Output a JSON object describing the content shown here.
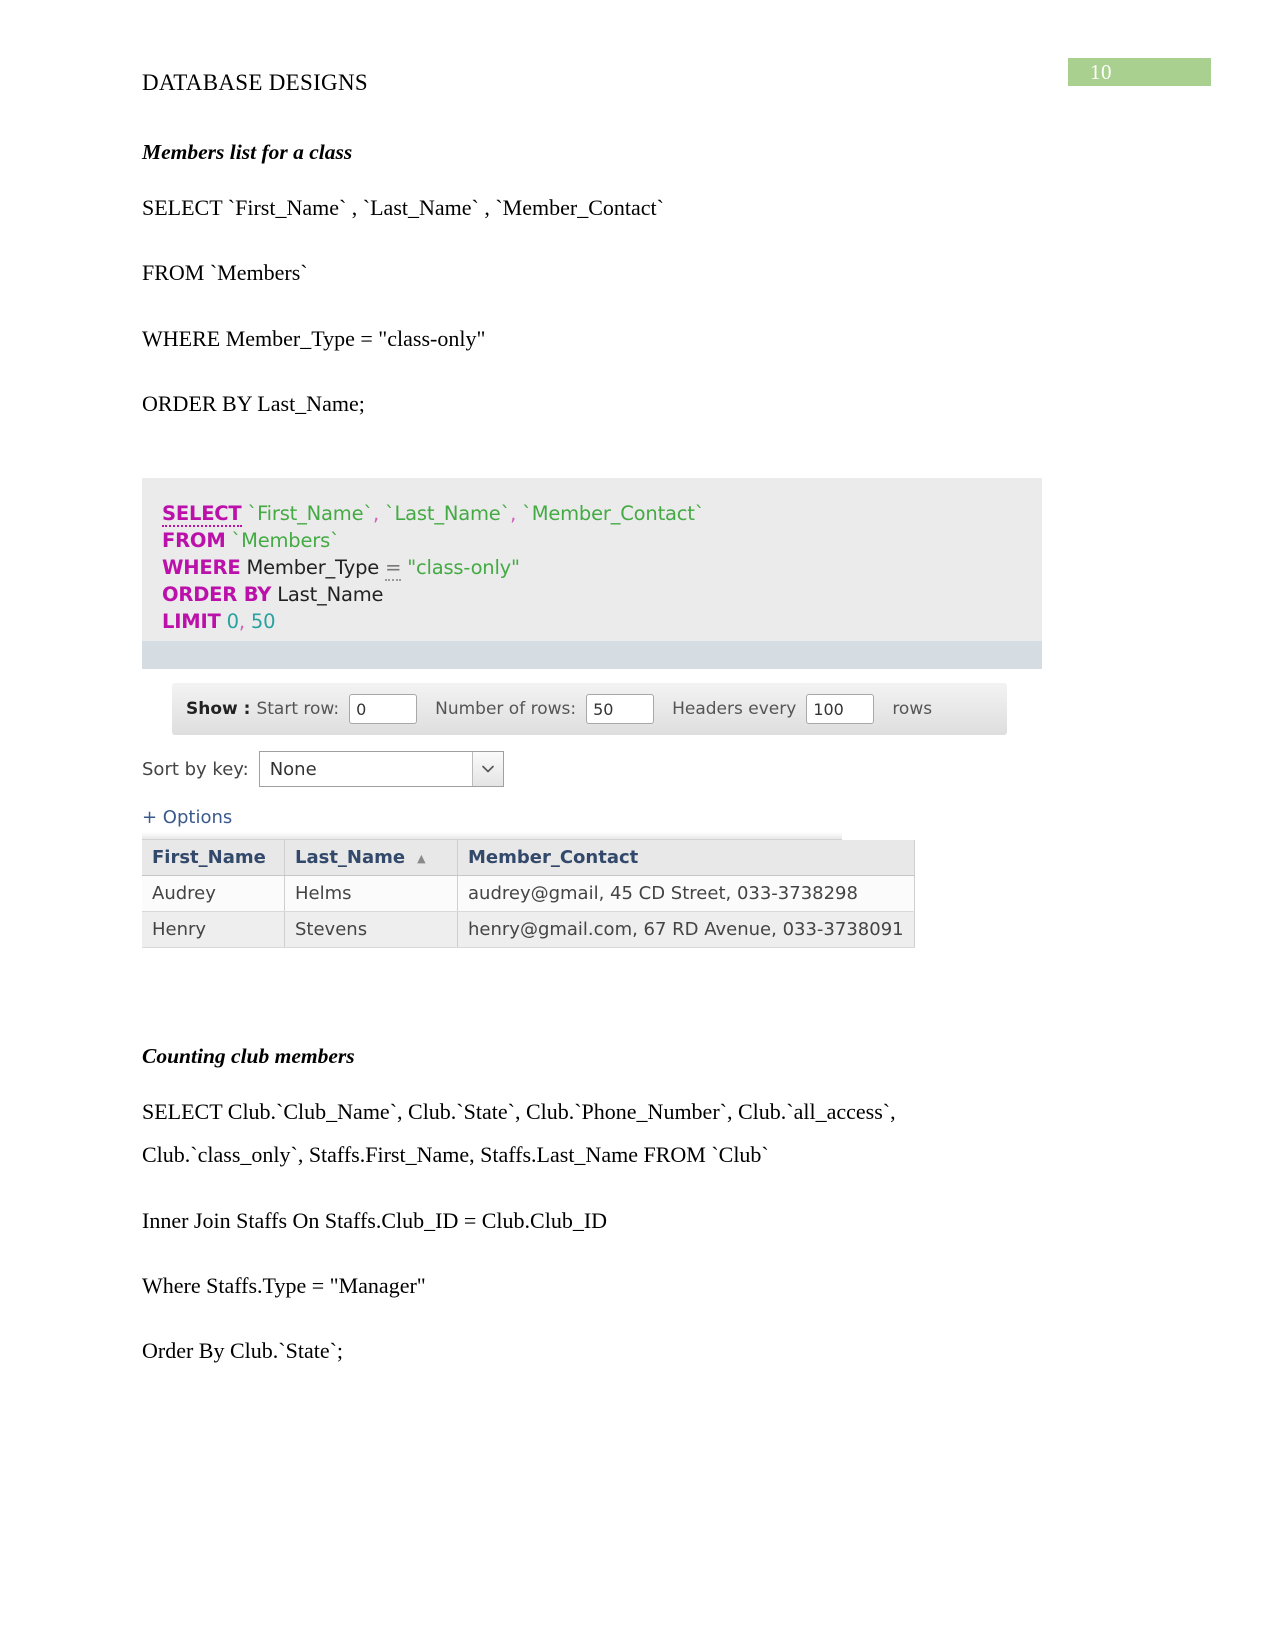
{
  "page": {
    "number": "10",
    "header_title": "DATABASE DESIGNS",
    "badge_color": "#a9d08e"
  },
  "section1": {
    "heading": "Members list for a class",
    "lines": [
      "SELECT `First_Name` , `Last_Name` , `Member_Contact`",
      "FROM `Members`",
      "WHERE Member_Type = \"class-only\"",
      "ORDER BY Last_Name;"
    ]
  },
  "screenshot": {
    "sql": {
      "line1": {
        "keyword": "SELECT",
        "f1": "`First_Name`",
        "c1": ",",
        "f2": "`Last_Name`",
        "c2": ",",
        "f3": "`Member_Contact`"
      },
      "line2": {
        "keyword": "FROM",
        "table": "`Members`"
      },
      "line3": {
        "keyword": "WHERE",
        "column": "Member_Type",
        "operator": "=",
        "value": "\"class-only\""
      },
      "line4": {
        "keyword": "ORDER BY",
        "column": "Last_Name"
      },
      "line5": {
        "keyword": "LIMIT",
        "start": "0",
        "comma": ",",
        "count": "50"
      }
    },
    "show_bar": {
      "show_label": "Show :",
      "start_row_label": "Start row:",
      "start_row_value": "0",
      "num_rows_label": "Number of rows:",
      "num_rows_value": "50",
      "headers_every_label": "Headers every",
      "headers_every_value": "100",
      "rows_suffix": "rows"
    },
    "sort_by": {
      "label": "Sort by key:",
      "selected": "None",
      "options": [
        "None"
      ]
    },
    "options_link": "+ Options",
    "results": {
      "columns": [
        "First_Name",
        "Last_Name",
        "Member_Contact"
      ],
      "sorted_column": "Last_Name",
      "sort_direction_glyph": "▲",
      "rows": [
        {
          "first_name": "Audrey",
          "last_name": "Helms",
          "member_contact": "audrey@gmail, 45 CD Street, 033-3738298"
        },
        {
          "first_name": "Henry",
          "last_name": "Stevens",
          "member_contact": "henry@gmail.com, 67 RD Avenue, 033-3738091"
        }
      ]
    }
  },
  "section2": {
    "heading": "Counting club members",
    "line1": "SELECT    Club.`Club_Name`,    Club.`State`,    Club.`Phone_Number`,    Club.`all_access`,",
    "line2": "Club.`class_only`, Staffs.First_Name, Staffs.Last_Name FROM `Club`",
    "line3": "Inner Join Staffs On Staffs.Club_ID = Club.Club_ID",
    "line4": "Where Staffs.Type = \"Manager\"",
    "line5": "Order By Club.`State`;"
  }
}
